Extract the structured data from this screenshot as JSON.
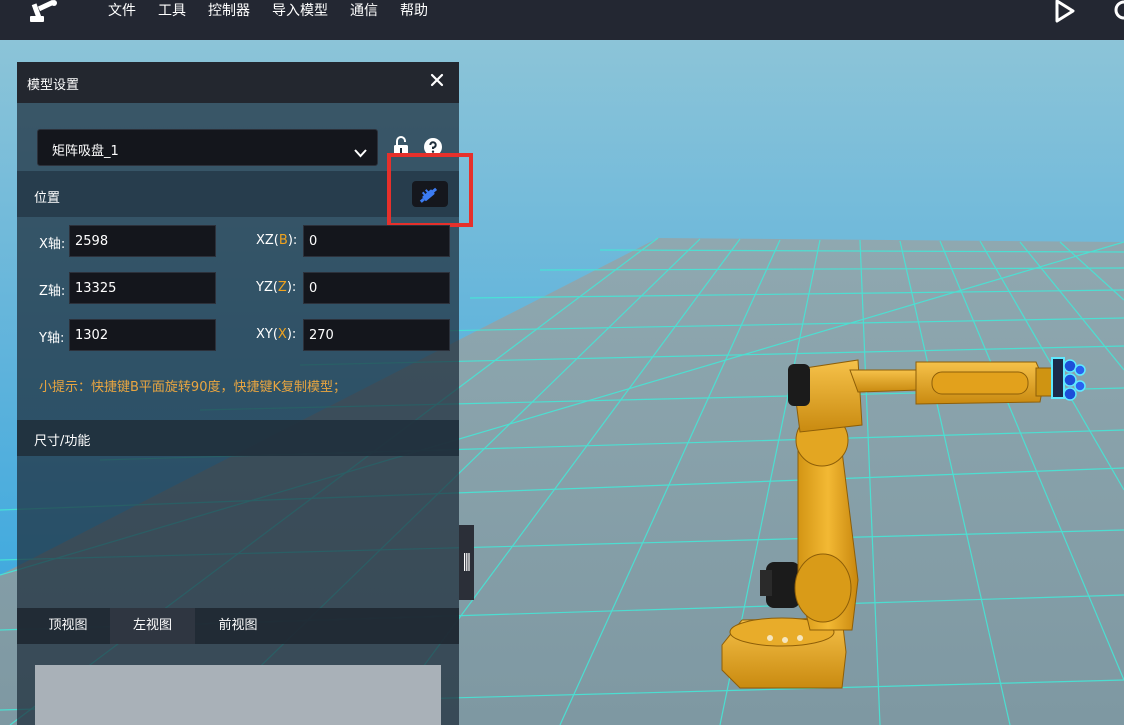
{
  "menu": {
    "items": [
      "文件",
      "工具",
      "控制器",
      "导入模型",
      "通信",
      "帮助"
    ]
  },
  "icons": {
    "logo": "robot-arm-logo-icon",
    "play": "play-icon",
    "close": "close-icon",
    "lock": "unlock-icon",
    "help": "help-icon",
    "pick": "pick-position-icon",
    "dropdown": "chevron-down-icon"
  },
  "panel": {
    "title": "模型设置",
    "model_select": {
      "value": "矩阵吸盘_1"
    },
    "position_section": {
      "title": "位置"
    },
    "fields": {
      "x": {
        "label": "X轴:",
        "value": "2598"
      },
      "z": {
        "label": "Z轴:",
        "value": "13325"
      },
      "y": {
        "label": "Y轴:",
        "value": "1302"
      },
      "xz": {
        "label_prefix": "XZ(",
        "axis": "B",
        "label_suffix": "):",
        "value": "0"
      },
      "yz": {
        "label_prefix": "YZ(",
        "axis": "Z",
        "label_suffix": "):",
        "value": "0"
      },
      "xy": {
        "label_prefix": "XY(",
        "axis": "X",
        "label_suffix": "):",
        "value": "270"
      }
    },
    "tip": "小提示：快捷键B平面旋转90度，快捷键K复制模型；",
    "size_section": {
      "title": "尺寸/功能"
    },
    "view_tabs": [
      {
        "label": "顶视图",
        "active": false
      },
      {
        "label": "左视图",
        "active": true
      },
      {
        "label": "前视图",
        "active": false
      }
    ]
  },
  "colors": {
    "topbar": "#232732",
    "accent_orange": "#f0a31f",
    "tip_text": "#e9a540",
    "highlight_red": "#e6302b",
    "pick_icon_blue": "#3c7cf2",
    "grid_line": "#46e6d6",
    "robot_yellow": "#e9a21a"
  }
}
